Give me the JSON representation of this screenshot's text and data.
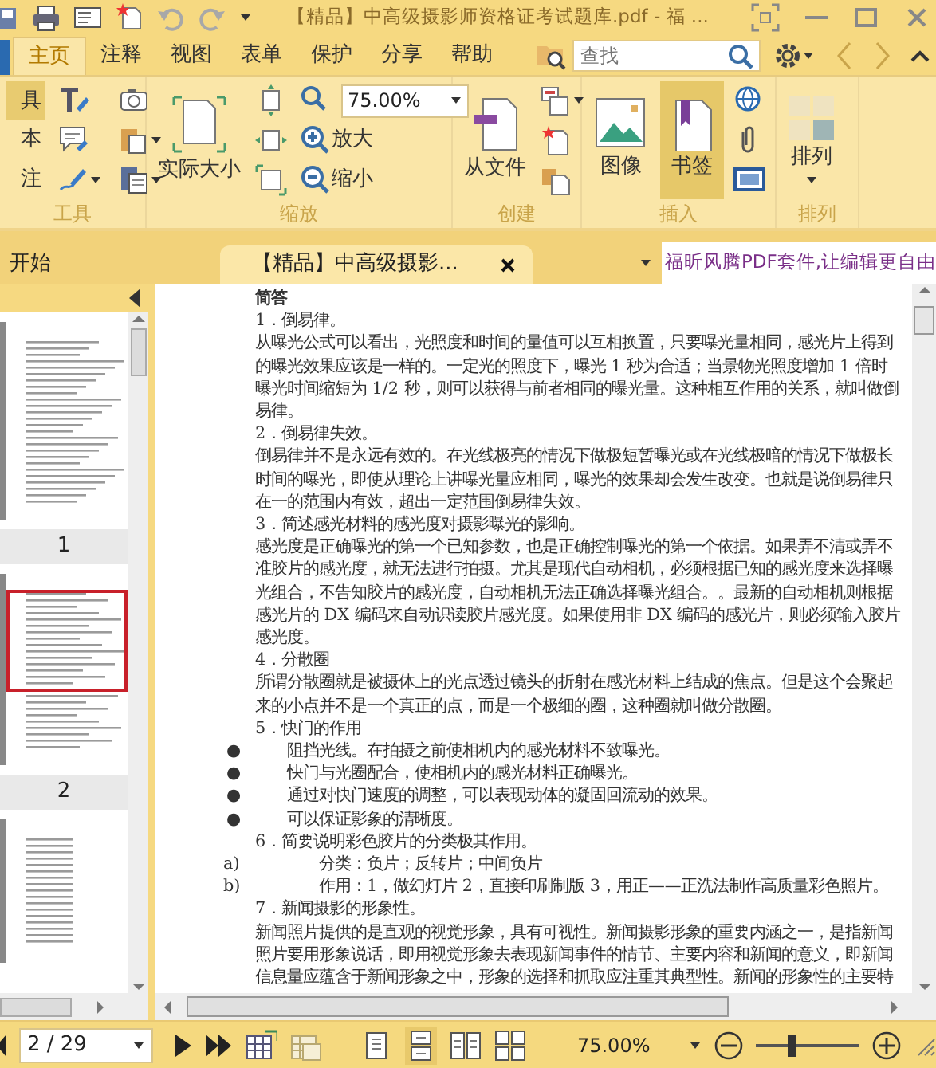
{
  "title_bar": {
    "title": "【精品】中高级摄影师资格证考试题库.pdf - 福 ..."
  },
  "menu_tabs": [
    {
      "label": "主页",
      "selected": true
    },
    {
      "label": "注释",
      "selected": false
    },
    {
      "label": "视图",
      "selected": false
    },
    {
      "label": "表单",
      "selected": false
    },
    {
      "label": "保护",
      "selected": false
    },
    {
      "label": "分享",
      "selected": false
    },
    {
      "label": "帮助",
      "selected": false
    }
  ],
  "search": {
    "placeholder": "查找"
  },
  "ribbon": {
    "tools": {
      "label": "工具",
      "items": [
        {
          "label": "具",
          "selected": true
        },
        {
          "label": "本",
          "selected": false
        },
        {
          "label": "注",
          "selected": false
        }
      ]
    },
    "zoom": {
      "label": "缩放",
      "actual_size": "实际大小",
      "zoom_value": "75.00%",
      "zoom_in": "放大",
      "zoom_out": "缩小"
    },
    "create": {
      "label": "创建",
      "from_file": "从文件"
    },
    "insert": {
      "label": "插入",
      "buttons": [
        {
          "label": "图像",
          "selected": false
        },
        {
          "label": "书签",
          "selected": true
        }
      ]
    },
    "arrange": {
      "label": "排列",
      "button": "排列"
    }
  },
  "document_tabs": [
    {
      "label": "开始",
      "selected": false,
      "closable": false
    },
    {
      "label": "【精品】中高级摄影...",
      "selected": true,
      "closable": true
    }
  ],
  "ad_banner": "福昕风腾PDF套件,让编辑更自由",
  "thumbnails": [
    {
      "label": "1",
      "selected": false
    },
    {
      "label": "2",
      "selected": true
    },
    {
      "selected": false
    }
  ],
  "document": {
    "blocks": [
      {
        "kind": "heading",
        "text": "简答"
      },
      {
        "kind": "para",
        "text": "1．倒易律。"
      },
      {
        "kind": "para",
        "text": "从曝光公式可以看出，光照度和时间的量值可以互相换置，只要曝光量相同，感光片上得到的曝光效果应该是一样的。一定光的照度下，曝光 1 秒为合适；当景物光照度增加 1 倍时曝光时间缩短为 1/2 秒，则可以获得与前者相同的曝光量。这种相互作用的关系，就叫做倒易律。"
      },
      {
        "kind": "para",
        "text": "2．倒易律失效。"
      },
      {
        "kind": "para",
        "text": "倒易律并不是永远有效的。在光线极亮的情况下做极短暂曝光或在光线极暗的情况下做极长时间的曝光，即使从理论上讲曝光量应相同，曝光的效果却会发生改变。也就是说倒易律只在一的范围内有效，超出一定范围倒易律失效。"
      },
      {
        "kind": "para",
        "text": "3．简述感光材料的感光度对摄影曝光的影响。"
      },
      {
        "kind": "para",
        "text": "感光度是正确曝光的第一个已知参数，也是正确控制曝光的第一个依据。如果弄不清或弄不准胶片的感光度，就无法进行拍摄。尤其是现代自动相机，必须根据已知的感光度来选择曝光组合，不告知胶片的感光度，自动相机无法正确选择曝光组合。。最新的自动相机则根据感光片的 DX 编码来自动识读胶片感光度。如果使用非 DX 编码的感光片，则必须输入胶片感光度。"
      },
      {
        "kind": "para",
        "text": "4．分散圈"
      },
      {
        "kind": "para",
        "text": "所谓分散圈就是被摄体上的光点透过镜头的折射在感光材料上结成的焦点。但是这个会聚起来的小点并不是一个真正的点，而是一个极细的圈，这种圈就叫做分散圈。"
      },
      {
        "kind": "para",
        "text": "5．快门的作用"
      },
      {
        "kind": "bullet",
        "marker": "●",
        "text": "阻挡光线。在拍摄之前使相机内的感光材料不致曝光。"
      },
      {
        "kind": "bullet",
        "marker": "●",
        "text": "快门与光圈配合，使相机内的感光材料正确曝光。"
      },
      {
        "kind": "bullet",
        "marker": "●",
        "text": "通过对快门速度的调整，可以表现动体的凝固回流动的效果。"
      },
      {
        "kind": "bullet",
        "marker": "●",
        "text": "可以保证影象的清晰度。"
      },
      {
        "kind": "para",
        "text": "6．简要说明彩色胶片的分类极其作用。"
      },
      {
        "kind": "lettered",
        "marker": "a)",
        "text": "分类：负片；反转片；中间负片"
      },
      {
        "kind": "lettered",
        "marker": "b)",
        "text": "作用：1，做幻灯片 2，直接印刷制版 3，用正——正洗法制作高质量彩色照片。"
      },
      {
        "kind": "para",
        "text": "7．新闻摄影的形象性。"
      },
      {
        "kind": "para",
        "text": "新闻照片提供的是直观的视觉形象，具有可视性。新闻摄影形象的重要内涵之一，是指新闻照片要用形象说话，即用视觉形象去表现新闻事件的情节、主要内容和新闻的意义，即新闻信息量应蕴含于新闻形象之中，形象的选择和抓取应注重其典型性。新闻的形象性的主要特"
      }
    ]
  },
  "status_bar": {
    "page": "2 / 29",
    "zoom": "75.00%",
    "level": 0.34,
    "views": [
      {
        "selected": false
      },
      {
        "selected": true
      },
      {
        "selected": false
      },
      {
        "selected": false
      }
    ]
  }
}
